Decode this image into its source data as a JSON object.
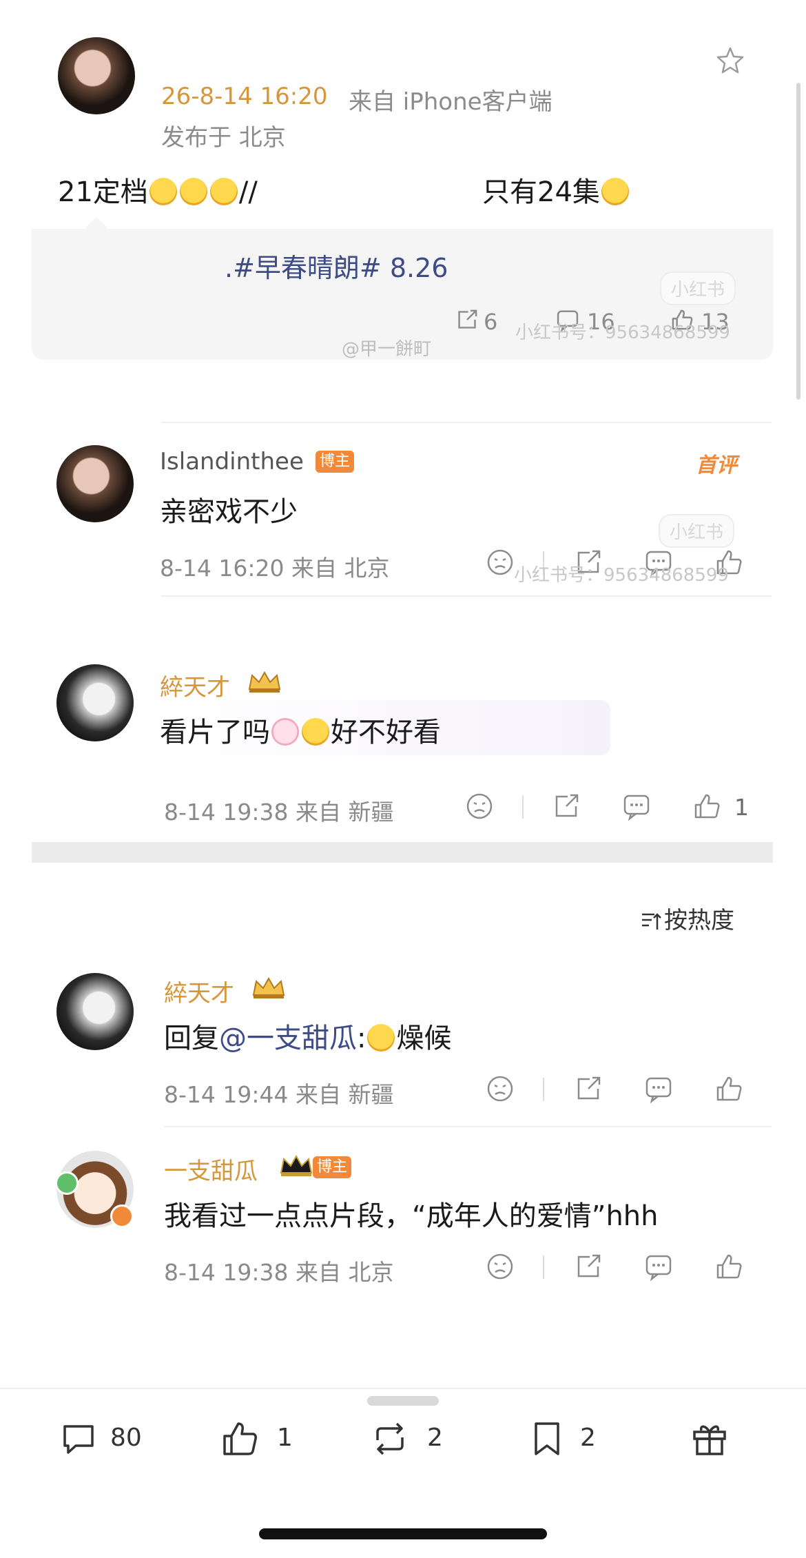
{
  "post": {
    "timestamp": "26-8-14 16:20",
    "source": "来自 iPhone客户端",
    "location": "发布于 北京",
    "content_prefix": "21定档",
    "content_slash": "//",
    "content_suffix": "只有24集",
    "quote_text": ".#早春晴朗# 8.26",
    "quote_repost_count": "6",
    "quote_comment_count": "16",
    "quote_like_count": "13",
    "weibo_watermark": "@甲一餅町",
    "xhs_watermark": "小红书号：95634868599",
    "xhs_pill": "小红书"
  },
  "comments": [
    {
      "username": "Islandinthee",
      "badge": "博主",
      "first_tag": "首评",
      "text": "亲密戏不少",
      "time": "8-14 16:20 来自 北京",
      "xhs_watermark": "小红书号：95634868599",
      "xhs_pill": "小红书"
    },
    {
      "username": "綷天才",
      "text_prefix": "看片了吗",
      "text_suffix": "好不好看",
      "time": "8-14 19:38 来自 新疆",
      "like_count": "1"
    }
  ],
  "sort_label": "按热度",
  "replies": [
    {
      "username": "綷天才",
      "reply_prefix": "回复",
      "mention": "@一支甜瓜",
      "colon": ":",
      "text": "燥候",
      "time": "8-14 19:44 来自 新疆"
    },
    {
      "username": "一支甜瓜",
      "badge": "博主",
      "text": "我看过一点点片段，“成年人的爱情”hhh",
      "time": "8-14 19:38 来自 北京"
    }
  ],
  "bottom_bar": {
    "comments": "80",
    "likes": "1",
    "reposts": "2",
    "favorites": "2"
  },
  "colors": {
    "accent_orange": "#d6963a",
    "badge_orange": "#f08a3a",
    "topic_blue": "#3d4c86"
  }
}
